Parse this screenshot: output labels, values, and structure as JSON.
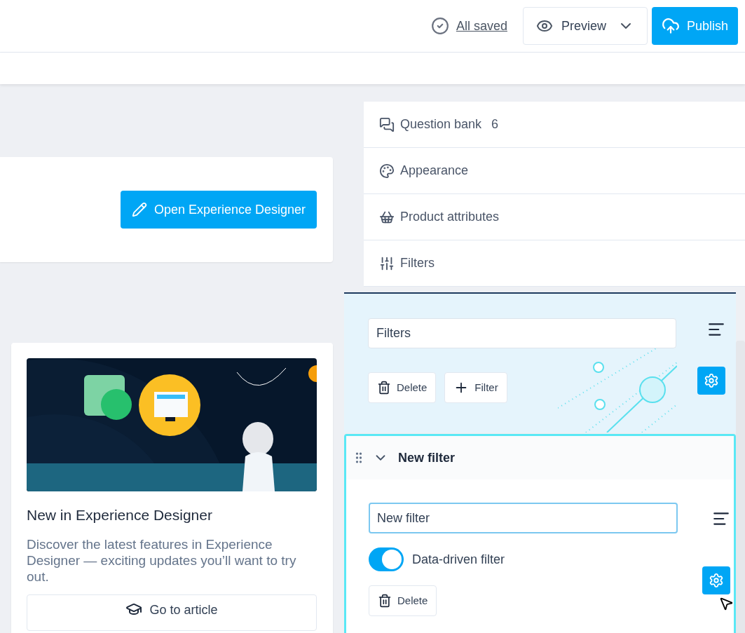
{
  "header": {
    "save_status": "All saved",
    "preview": "Preview",
    "publish": "Publish"
  },
  "designer_card": {
    "button": "Open Experience Designer"
  },
  "news_card": {
    "title": "New in Experience Designer",
    "description": "Discover the latest features in Experience Designer — exciting updates you’ll want to try out.",
    "button": "Go to article"
  },
  "panel": {
    "sections": [
      {
        "kind": "questions",
        "label": "Question bank",
        "count": "6"
      },
      {
        "kind": "appearance",
        "label": "Appearance"
      },
      {
        "kind": "attributes",
        "label": "Product attributes"
      },
      {
        "kind": "filters",
        "label": "Filters"
      }
    ]
  },
  "filters_group": {
    "name_value": "Filters",
    "delete": "Delete",
    "add": "Filter"
  },
  "filter_item": {
    "title": "New filter",
    "expanded": true,
    "name_value": "New filter",
    "toggle": {
      "label": "Data-driven filter",
      "on": true
    },
    "delete": "Delete"
  }
}
